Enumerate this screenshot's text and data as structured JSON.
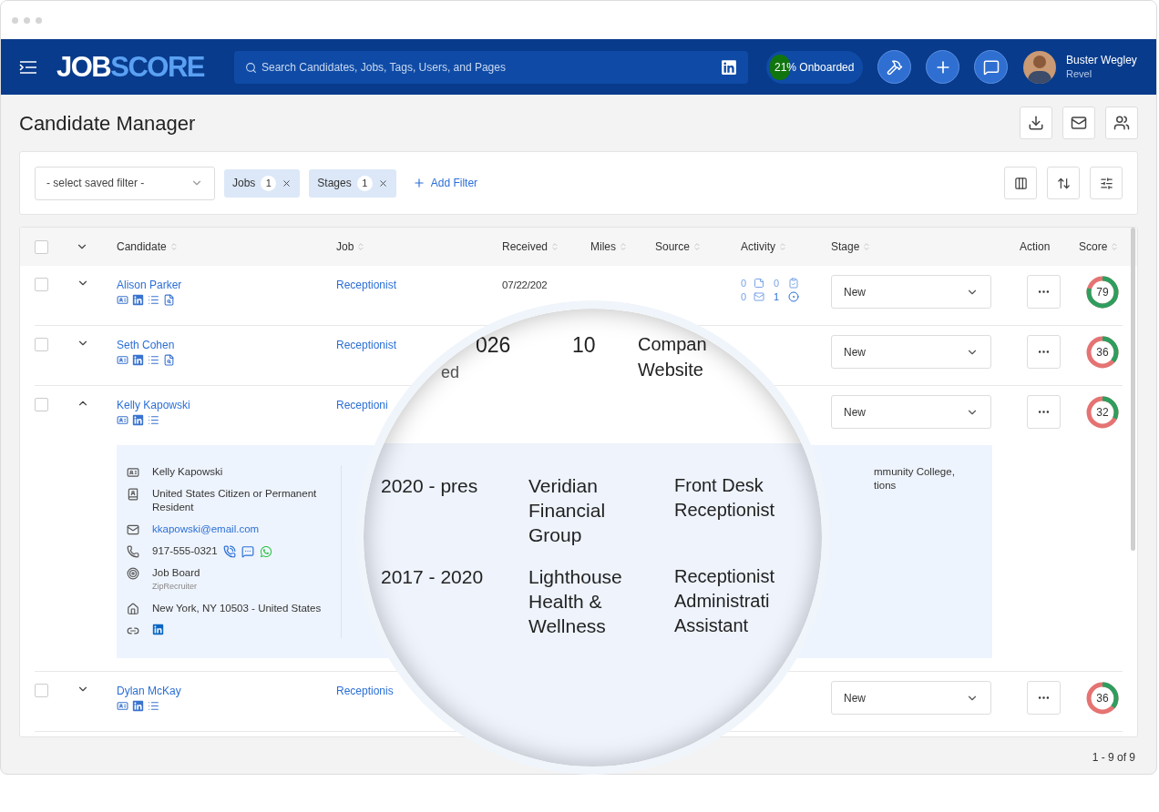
{
  "header": {
    "logo": {
      "first": "JOB",
      "second": "SCORE"
    },
    "search": {
      "placeholder": "Search Candidates, Jobs, Tags, Users, and Pages"
    },
    "onboarding": {
      "label": "21% Onboarded"
    },
    "user": {
      "name": "Buster Wegley",
      "company": "Revel"
    }
  },
  "page": {
    "title": "Candidate Manager"
  },
  "filters": {
    "saved_filter": {
      "placeholder": "- select saved filter -"
    },
    "chips": [
      {
        "label": "Jobs",
        "count": "1"
      },
      {
        "label": "Stages",
        "count": "1"
      }
    ],
    "add_filter": "Add Filter"
  },
  "table": {
    "columns": [
      {
        "label": "Candidate",
        "sortable": true
      },
      {
        "label": "Job",
        "sortable": true
      },
      {
        "label": "Received",
        "sortable": true
      },
      {
        "label": "Miles",
        "sortable": true
      },
      {
        "label": "Source",
        "sortable": true
      },
      {
        "label": "Activity",
        "sortable": true
      },
      {
        "label": "Stage",
        "sortable": true
      },
      {
        "label": "Action",
        "sortable": false
      },
      {
        "label": "Score",
        "sortable": true
      }
    ],
    "select_all_checked": false,
    "rows": [
      {
        "checked": false,
        "name": "Alison Parker",
        "screened": true,
        "job": "Receptionist",
        "received": "07/22/202",
        "activity": [
          "0",
          "0",
          "0",
          "1"
        ],
        "stage": "New",
        "score": "79",
        "level": 0.79,
        "expanded": false
      },
      {
        "checked": false,
        "name": "Seth Cohen",
        "screened": true,
        "job": "Receptionist",
        "stage": "New",
        "score": "36",
        "level": 0.36,
        "expanded": false
      },
      {
        "checked": false,
        "name": "Kelly Kapowski",
        "screened": false,
        "job": "Receptioni",
        "stage": "New",
        "score": "32",
        "level": 0.32,
        "expanded": true,
        "details": [
          {
            "kind": "name",
            "text": "Kelly Kapowski"
          },
          {
            "kind": "status",
            "text": "United States Citizen or Permanent Resident"
          },
          {
            "kind": "email",
            "text": "kkapowski@email.com"
          },
          {
            "kind": "phone",
            "text": "917-555-0321"
          },
          {
            "kind": "source",
            "text": "Job Board",
            "sub": "ZipRecruiter"
          },
          {
            "kind": "address",
            "text": "New York, NY 10503 - United States"
          },
          {
            "kind": "links"
          }
        ],
        "education": [
          "mmunity College,",
          "tions"
        ]
      },
      {
        "checked": false,
        "name": "Dylan McKay",
        "screened": false,
        "job": "Receptionis",
        "stage": "New",
        "score": "36",
        "level": 0.36,
        "expanded": false
      }
    ],
    "pagination": "1 - 9 of 9"
  },
  "magnifier": {
    "received": "026",
    "received_sub": "ed",
    "miles": "10",
    "source": "Compan Website",
    "experience": [
      {
        "years": "2020 - pres",
        "company": "Veridian Financial Group",
        "title": "Front Desk Receptionist"
      },
      {
        "years": "2017 - 2020",
        "company": "Lighthouse Health & Wellness",
        "title": "Receptionist Administrati Assistant"
      }
    ]
  }
}
